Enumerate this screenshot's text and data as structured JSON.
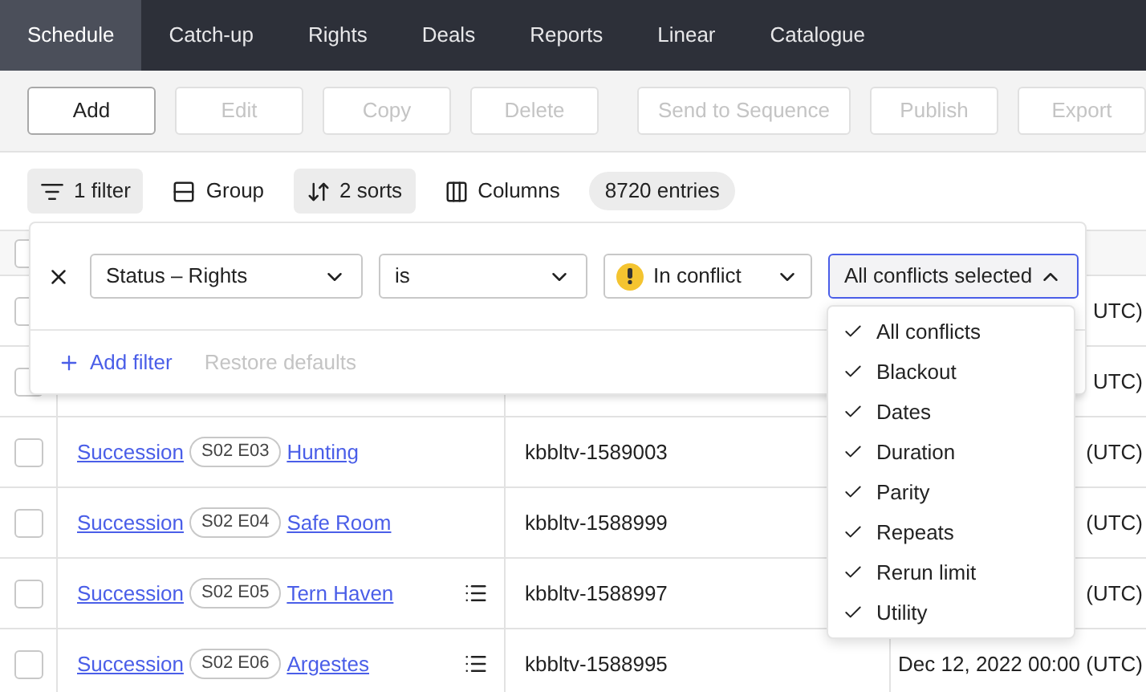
{
  "nav": {
    "tabs": [
      {
        "label": "Schedule",
        "selected": true
      },
      {
        "label": "Catch-up",
        "selected": false
      },
      {
        "label": "Rights",
        "selected": false
      },
      {
        "label": "Deals",
        "selected": false
      },
      {
        "label": "Reports",
        "selected": false
      },
      {
        "label": "Linear",
        "selected": false
      },
      {
        "label": "Catalogue",
        "selected": false
      }
    ]
  },
  "toolbar": {
    "groups": [
      [
        {
          "label": "Add",
          "disabled": false
        },
        {
          "label": "Edit",
          "disabled": true
        },
        {
          "label": "Copy",
          "disabled": true
        },
        {
          "label": "Delete",
          "disabled": true
        }
      ],
      [
        {
          "label": "Send to Sequence",
          "disabled": true
        },
        {
          "label": "Publish",
          "disabled": true
        },
        {
          "label": "Export",
          "disabled": true
        }
      ]
    ]
  },
  "view_bar": {
    "controls": [
      {
        "kind": "filter",
        "label": "1 filter",
        "active": true
      },
      {
        "kind": "group",
        "label": "Group",
        "active": false
      },
      {
        "kind": "sort",
        "label": "2 sorts",
        "active": true
      },
      {
        "kind": "columns",
        "label": "Columns",
        "active": false
      }
    ],
    "count": "8720 entries"
  },
  "table": {
    "header_checked": false,
    "rows": [
      {
        "checked": false,
        "date": "UTC)"
      },
      {
        "checked": false,
        "date": "UTC)"
      },
      {
        "checked": false,
        "series": "Succession",
        "episode": "S02 E03",
        "title": "Hunting",
        "id": "kbbltv-1589003",
        "has_notes": false,
        "date": "(UTC)"
      },
      {
        "checked": false,
        "series": "Succession",
        "episode": "S02 E04",
        "title": "Safe Room",
        "id": "kbbltv-1588999",
        "has_notes": false,
        "date": "(UTC)"
      },
      {
        "checked": false,
        "series": "Succession",
        "episode": "S02 E05",
        "title": "Tern Haven",
        "id": "kbbltv-1588997",
        "has_notes": true,
        "date": "(UTC)"
      },
      {
        "checked": false,
        "series": "Succession",
        "episode": "S02 E06",
        "title": "Argestes",
        "id": "kbbltv-1588995",
        "has_notes": true,
        "date": "Dec 12, 2022 00:00 (UTC)"
      }
    ]
  },
  "filter_panel": {
    "rule": {
      "field": "Status – Rights",
      "operator": "is",
      "value": "In conflict",
      "warning": true,
      "conflicts": "All conflicts selected",
      "open": true
    },
    "add_filter": "Add filter",
    "restore_defaults": "Restore defaults",
    "options": [
      {
        "label": "All conflicts",
        "checked": true
      },
      {
        "label": "Blackout",
        "checked": true
      },
      {
        "label": "Dates",
        "checked": true
      },
      {
        "label": "Duration",
        "checked": true
      },
      {
        "label": "Parity",
        "checked": true
      },
      {
        "label": "Repeats",
        "checked": true
      },
      {
        "label": "Rerun limit",
        "checked": true
      },
      {
        "label": "Utility",
        "checked": true
      }
    ]
  }
}
